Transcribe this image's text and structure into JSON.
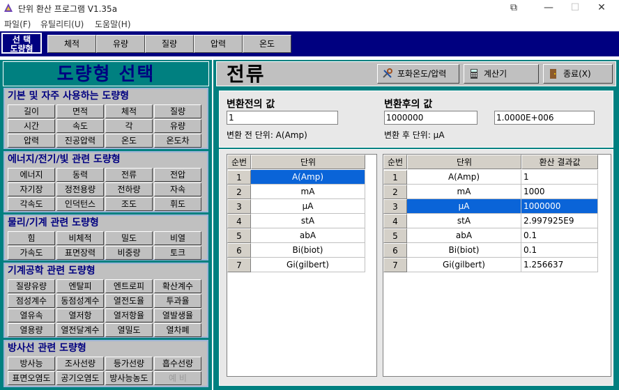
{
  "window": {
    "title": "단위 환산 프로그램 V1.35a",
    "controls": [
      "⧉",
      "—",
      "☐",
      "✕"
    ]
  },
  "menu": [
    "파일(F)",
    "유틸리티(U)",
    "도움말(H)"
  ],
  "strip": {
    "label_line1": "선 택",
    "label_line2": "도량형",
    "tabs": [
      "체적",
      "유량",
      "질량",
      "압력",
      "온도"
    ]
  },
  "left": {
    "title": "도량형 선택",
    "groups": [
      {
        "title": "기본 및 자주 사용하는 도량형",
        "rows": [
          [
            "길이",
            "면적",
            "체적",
            "질량"
          ],
          [
            "시간",
            "속도",
            "각",
            "유량"
          ],
          [
            "압력",
            "진공압력",
            "온도",
            "온도차"
          ]
        ]
      },
      {
        "title": "에너지/전기/빛 관련 도량형",
        "rows": [
          [
            "에너지",
            "동력",
            "전류",
            "전압"
          ],
          [
            "자기장",
            "정전용량",
            "전하량",
            "자속"
          ],
          [
            "각속도",
            "인덕턴스",
            "조도",
            "휘도"
          ]
        ]
      },
      {
        "title": "물리/기계 관련 도량형",
        "rows": [
          [
            "힘",
            "비체적",
            "밀도",
            "비열"
          ],
          [
            "가속도",
            "표면장력",
            "비중량",
            "토크"
          ]
        ]
      },
      {
        "title": "기계공학 관련 도량형",
        "rows": [
          [
            "질량유량",
            "엔탈피",
            "엔트로피",
            "확산계수"
          ],
          [
            "점성계수",
            "동점성계수",
            "열전도율",
            "투과율"
          ],
          [
            "열유속",
            "열저항",
            "열저항율",
            "열발생율"
          ],
          [
            "열용량",
            "열전달계수",
            "열밀도",
            "열차폐"
          ]
        ]
      },
      {
        "title": "방사선 관련 도량형",
        "rows": [
          [
            "방사능",
            "조사선량",
            "등가선량",
            "흡수선량"
          ],
          [
            "표면오염도",
            "공기오염도",
            "방사능농도",
            "예 비"
          ]
        ]
      }
    ]
  },
  "right": {
    "title": "전류",
    "buttons": {
      "saturation": "포화온도/압력",
      "calculator": "계산기",
      "exit": "종료(X)"
    },
    "before_label": "변환전의 값",
    "before_value": "1",
    "before_unit": "변환 전 단위: A(Amp)",
    "after_label": "변환후의 값",
    "after_value": "1000000",
    "after_sci": "1.0000E+006",
    "after_unit": "변환 후 단위: μA",
    "left_table": {
      "headers": [
        "순번",
        "단위"
      ],
      "rows": [
        [
          "1",
          "A(Amp)"
        ],
        [
          "2",
          "mA"
        ],
        [
          "3",
          "μA"
        ],
        [
          "4",
          "stA"
        ],
        [
          "5",
          "abA"
        ],
        [
          "6",
          "Bi(biot)"
        ],
        [
          "7",
          "Gi(gilbert)"
        ]
      ]
    },
    "right_table": {
      "headers": [
        "순번",
        "단위",
        "환산 결과값"
      ],
      "rows": [
        [
          "1",
          "A(Amp)",
          "1"
        ],
        [
          "2",
          "mA",
          "1000"
        ],
        [
          "3",
          "μA",
          "1000000"
        ],
        [
          "4",
          "stA",
          "2.997925E9"
        ],
        [
          "5",
          "abA",
          "0.1"
        ],
        [
          "6",
          "Bi(biot)",
          "0.1"
        ],
        [
          "7",
          "Gi(gilbert)",
          "1.256637"
        ]
      ]
    }
  }
}
